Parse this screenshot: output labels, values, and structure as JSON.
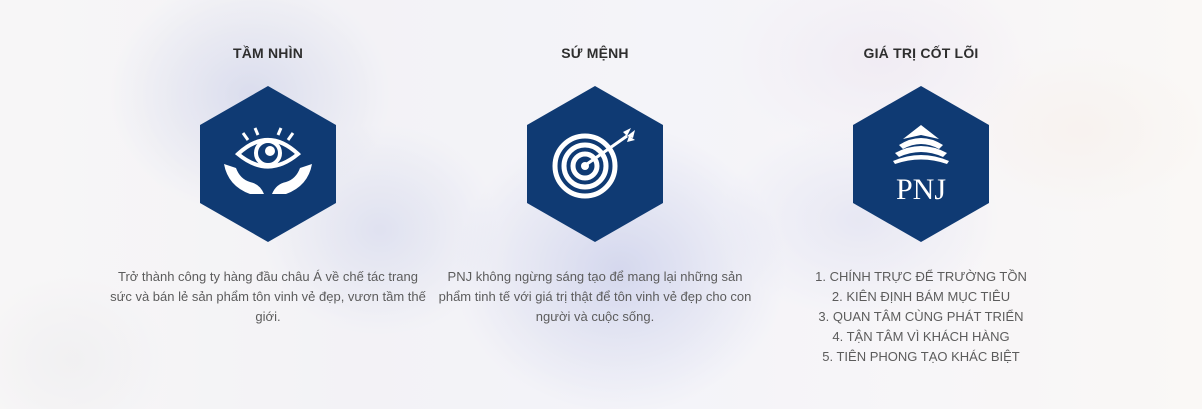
{
  "vision": {
    "title": "TẦM NHÌN",
    "icon": "eye-hands-icon",
    "description": "Trở thành công ty hàng đầu châu Á về chế tác trang sức và bán lẻ sản phẩm tôn vinh vẻ đẹp, vươn tầm thế giới."
  },
  "mission": {
    "title": "SỨ MỆNH",
    "icon": "target-arrow-icon",
    "description": "PNJ không ngừng sáng tạo để mang lại những sản phẩm tinh tế với giá trị thật để tôn vinh vẻ đẹp cho con người và cuộc sống."
  },
  "values": {
    "title": "GIÁ TRỊ CỐT LÕI",
    "icon": "pnj-logo",
    "logo_text": "PNJ",
    "items": [
      "1. CHÍNH TRỰC ĐỂ TRƯỜNG TỒN",
      "2. KIÊN ĐỊNH BÁM MỤC TIÊU",
      "3. QUAN TÂM CÙNG PHÁT TRIỂN",
      "4. TẬN TÂM VÌ KHÁCH HÀNG",
      "5. TIÊN PHONG TẠO KHÁC BIỆT"
    ]
  },
  "colors": {
    "hexagon": "#0f3a73",
    "title_text": "#2e2e2e",
    "body_text": "#5c5c5c"
  }
}
